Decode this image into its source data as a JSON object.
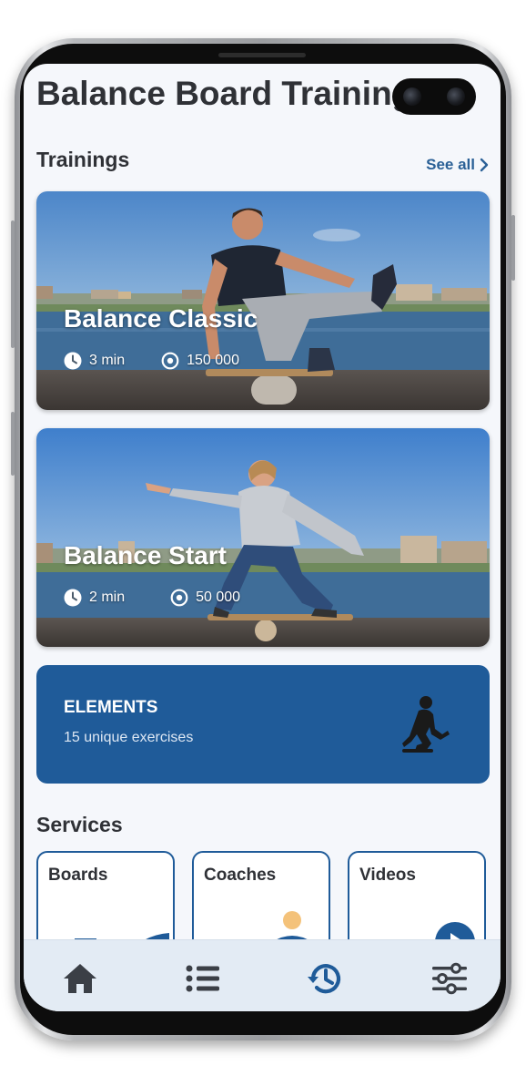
{
  "app": {
    "title": "Balance Board Training"
  },
  "trainings": {
    "heading": "Trainings",
    "see_all_label": "See all",
    "cards": [
      {
        "name": "Balance Classic",
        "duration": "3 min",
        "count": "150 000"
      },
      {
        "name": "Balance Start",
        "duration": "2 min",
        "count": "50 000"
      }
    ]
  },
  "elements": {
    "title": "ELEMENTS",
    "subtitle": "15 unique exercises"
  },
  "services": {
    "heading": "Services",
    "items": [
      {
        "label": "Boards"
      },
      {
        "label": "Coaches"
      },
      {
        "label": "Videos"
      }
    ]
  },
  "nav": {
    "items": [
      {
        "icon": "home-icon",
        "active": false
      },
      {
        "icon": "list-icon",
        "active": false
      },
      {
        "icon": "history-icon",
        "active": true
      },
      {
        "icon": "settings-sliders-icon",
        "active": false
      }
    ]
  },
  "colors": {
    "accent": "#1f5b99",
    "link": "#2a6096",
    "screen_bg": "#f5f7fb",
    "nav_bg": "#e3ebf4",
    "title_text": "#2f3136",
    "nav_icon": "#3b3f46",
    "nav_icon_active": "#1f5b99"
  }
}
